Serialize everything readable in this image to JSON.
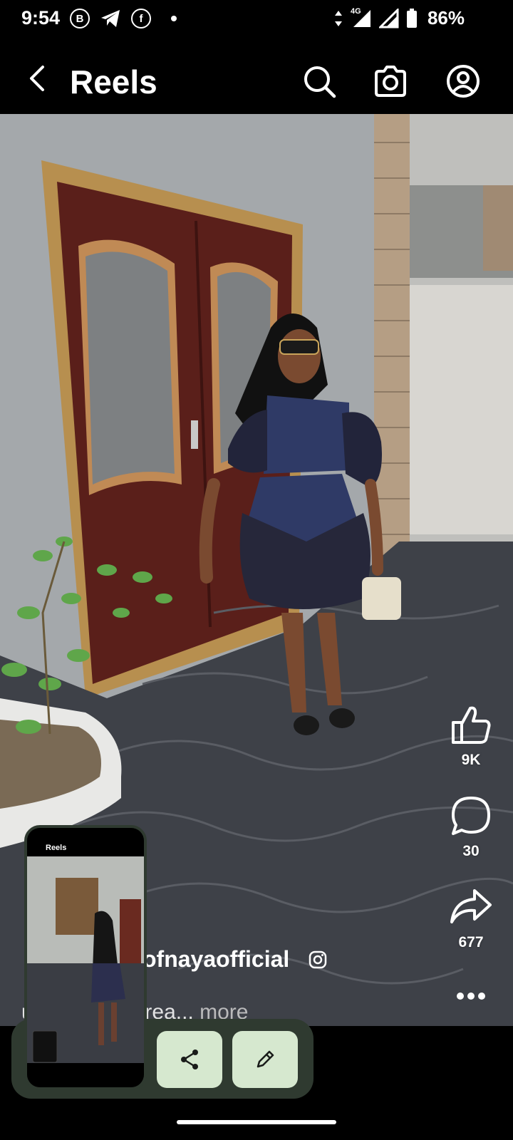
{
  "status_bar": {
    "time": "9:54",
    "network": "4G",
    "battery": "86%"
  },
  "header": {
    "title": "Reels"
  },
  "reel": {
    "likes": "9K",
    "comments": "30",
    "shares": "677",
    "username": "ofnayaofficial",
    "caption": "ul set is now rea...",
    "caption_more": "more"
  },
  "preview": {
    "title": "Reels"
  },
  "colors": {
    "overlay_bg": "#2f3a30",
    "action_button": "#d6e8cf"
  }
}
